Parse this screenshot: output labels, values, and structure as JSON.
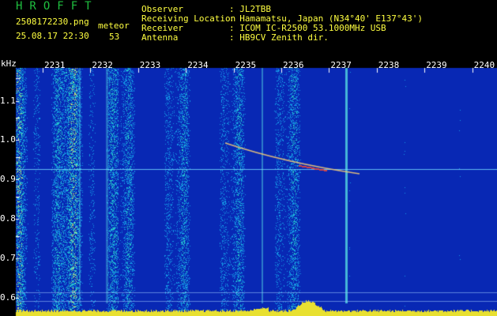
{
  "header": {
    "logo": "HROFFT",
    "filename": "2508172230.png",
    "datetime": "25.08.17 22:30",
    "category": "meteor",
    "count": "53",
    "fields": [
      {
        "label": "Observer",
        "value": ": JL2TBB"
      },
      {
        "label": "Receiving Location",
        "value": ": Hamamatsu, Japan (N34°40' E137°43')"
      },
      {
        "label": "Receiver",
        "value": ": ICOM IC-R2500 53.1000MHz USB"
      },
      {
        "label": "Antenna",
        "value": ": HB9CV Zenith dir."
      }
    ]
  },
  "spectrogram": {
    "y_unit": "kHz",
    "y_ticks": [
      "1.1",
      "1.0",
      "0.9",
      "0.8",
      "0.7",
      "0.6"
    ],
    "x_ticks": [
      "2231",
      "2232",
      "2233",
      "2234",
      "2235",
      "2236",
      "2237",
      "2238",
      "2239",
      "2240"
    ],
    "colors": {
      "background": "#000000",
      "noise_base": "#0a2fb4",
      "text_yellow": "#ffff40",
      "logo_green": "#1fbf3f",
      "tick_white": "#ffffff"
    }
  }
}
